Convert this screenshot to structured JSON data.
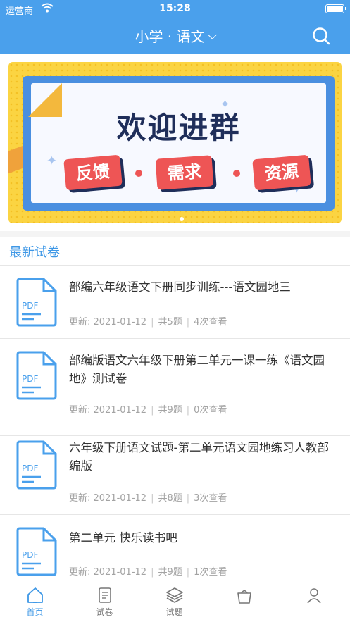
{
  "status_bar": {
    "carrier": "运营商",
    "time": "15:28"
  },
  "nav": {
    "title": "小学 · 语文"
  },
  "banner": {
    "title": "欢迎进群",
    "tags": [
      "反馈",
      "需求",
      "资源"
    ]
  },
  "section": {
    "title": "最新试卷"
  },
  "papers": [
    {
      "title": "部编六年级语文下册同步训练---语文园地三",
      "icon_label": "PDF",
      "updated": "更新: 2021-01-12",
      "count": "共5题",
      "views": "4次查看"
    },
    {
      "title": "部编版语文六年级下册第二单元一课一练《语文园地》测试卷",
      "icon_label": "PDF",
      "updated": "更新: 2021-01-12",
      "count": "共9题",
      "views": "0次查看"
    },
    {
      "title": "六年级下册语文试题-第二单元语文园地练习人教部编版",
      "icon_label": "PDF",
      "updated": "更新: 2021-01-12",
      "count": "共8题",
      "views": "3次查看"
    },
    {
      "title": "第二单元 快乐读书吧",
      "icon_label": "PDF",
      "updated": "更新: 2021-01-12",
      "count": "共9题",
      "views": "1次查看"
    }
  ],
  "tabbar": {
    "tabs": [
      {
        "label": "首页",
        "icon": "home-icon",
        "active": true
      },
      {
        "label": "试卷",
        "icon": "paper-icon",
        "active": false
      },
      {
        "label": "试题",
        "icon": "layers-icon",
        "active": false
      },
      {
        "label": "",
        "icon": "bag-icon",
        "active": false
      },
      {
        "label": "",
        "icon": "user-icon",
        "active": false
      }
    ]
  },
  "colors": {
    "primary": "#4aa0ec",
    "accent_text": "#3d97e6",
    "banner_yellow": "#fbd442",
    "tag_red": "#ee5555"
  }
}
